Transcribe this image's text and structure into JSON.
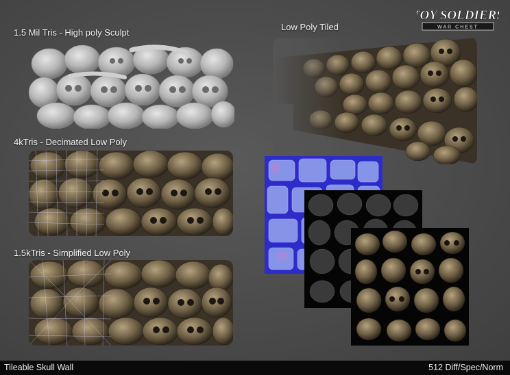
{
  "logo": {
    "title": "TOY SOLDIERS",
    "subtitle": "WAR CHEST"
  },
  "labels": {
    "high_poly": "1.5 Mil Tris - High poly Sculpt",
    "low_poly_tiled": "Low Poly Tiled",
    "decimated": "4kTris - Decimated Low Poly",
    "simplified": "1.5kTris - Simplified Low Poly"
  },
  "footer": {
    "left": "Tileable Skull Wall",
    "right": "512 Diff/Spec/Norm"
  },
  "colors": {
    "background": "#4a4a4a",
    "clay": "#b9b9b9",
    "bone": "#7a6a50",
    "normal_map": "#5a5ad8",
    "spec_map": "#2a2a2a",
    "footer_bar": "#0a0a0a"
  }
}
